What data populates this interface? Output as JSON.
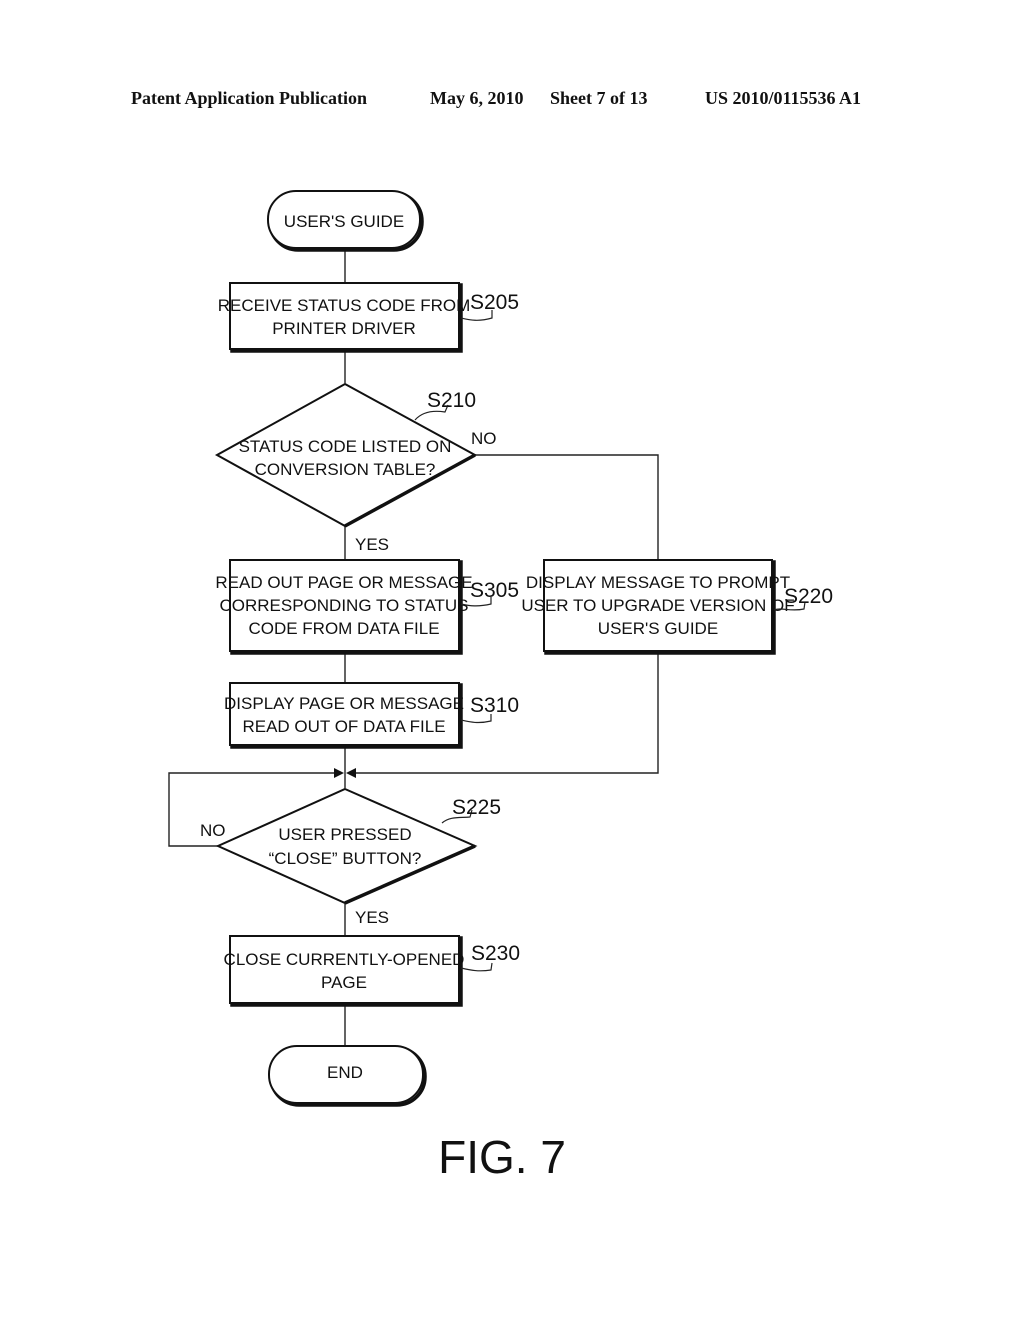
{
  "header": {
    "publication": "Patent Application Publication",
    "date": "May 6, 2010",
    "sheet": "Sheet 7 of 13",
    "number": "US 2010/0115536 A1"
  },
  "flowchart": {
    "start": {
      "lines": [
        "USER'S GUIDE"
      ]
    },
    "s205": {
      "id": "S205",
      "lines": [
        "RECEIVE STATUS CODE FROM",
        "PRINTER DRIVER"
      ]
    },
    "s210": {
      "id": "S210",
      "lines": [
        "STATUS CODE LISTED ON",
        "CONVERSION TABLE?"
      ],
      "yes": "YES",
      "no": "NO"
    },
    "s305": {
      "id": "S305",
      "lines": [
        "READ OUT PAGE OR MESSAGE",
        "CORRESPONDING TO STATUS",
        "CODE FROM DATA FILE"
      ]
    },
    "s220": {
      "id": "S220",
      "lines": [
        "DISPLAY MESSAGE TO PROMPT",
        "USER TO UPGRADE VERSION OF",
        "USER'S GUIDE"
      ]
    },
    "s310": {
      "id": "S310",
      "lines": [
        "DISPLAY PAGE OR MESSAGE",
        "READ OUT OF DATA FILE"
      ]
    },
    "s225": {
      "id": "S225",
      "lines": [
        "USER PRESSED",
        "“CLOSE” BUTTON?"
      ],
      "yes": "YES",
      "no": "NO"
    },
    "s230": {
      "id": "S230",
      "lines": [
        "CLOSE CURRENTLY-OPENED",
        "PAGE"
      ]
    },
    "end": {
      "lines": [
        "END"
      ]
    }
  },
  "figure_label": "FIG. 7"
}
